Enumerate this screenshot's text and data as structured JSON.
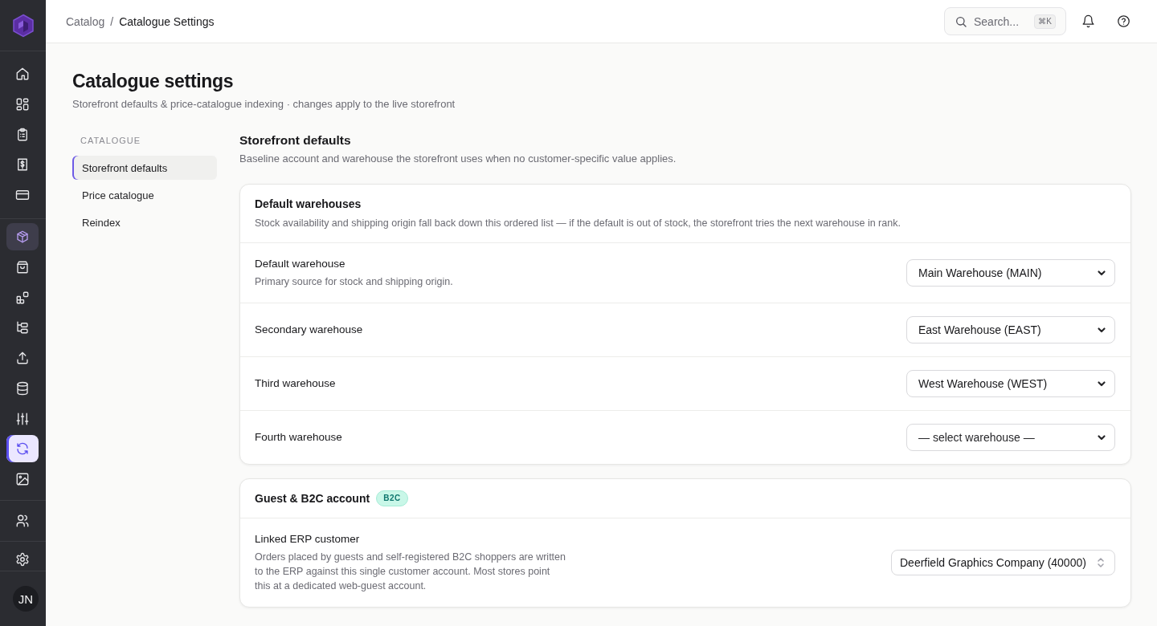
{
  "rail": {
    "groups": [
      {
        "items": [
          {
            "selected": false,
            "focused": false
          },
          {
            "selected": false,
            "focused": false
          },
          {
            "selected": false,
            "focused": false
          },
          {
            "selected": false,
            "focused": false
          },
          {
            "selected": false,
            "focused": false
          }
        ]
      },
      {
        "items": [
          {
            "selected": true,
            "focused": false
          },
          {
            "selected": false,
            "focused": false
          },
          {
            "selected": false,
            "focused": false
          },
          {
            "selected": false,
            "focused": false
          },
          {
            "selected": false,
            "focused": false
          },
          {
            "selected": false,
            "focused": false
          },
          {
            "selected": false,
            "focused": false
          },
          {
            "selected": false,
            "focused": true
          },
          {
            "selected": false,
            "focused": false
          }
        ]
      },
      {
        "items": [
          {
            "selected": false,
            "focused": false
          }
        ]
      },
      {
        "items": [
          {
            "selected": false,
            "focused": false
          }
        ]
      }
    ],
    "avatar": "JN"
  },
  "topbar": {
    "breadcrumb": [
      {
        "label": "Catalog",
        "current": false
      },
      {
        "label": "Catalogue Settings",
        "current": true
      }
    ],
    "separator": "/",
    "search": {
      "placeholder": "Search...",
      "shortcut": "⌘K"
    }
  },
  "page": {
    "title": "Catalogue settings",
    "subtitle": "Storefront defaults & price-catalogue indexing · changes apply to the live storefront"
  },
  "subnav": {
    "heading": "CATALOGUE",
    "items": [
      {
        "label": "Storefront defaults",
        "selected": true
      },
      {
        "label": "Price catalogue",
        "selected": false
      },
      {
        "label": "Reindex",
        "selected": false
      }
    ]
  },
  "section": {
    "title": "Storefront defaults",
    "description": "Baseline account and warehouse the storefront uses when no customer-specific value applies.",
    "cards": [
      {
        "title": "Default warehouses",
        "description": "Stock availability and shipping origin fall back down this ordered list — if the default is out of stock, the storefront tries the next warehouse in rank.",
        "rows": [
          {
            "label": "Default warehouse",
            "description": "Primary source for stock and shipping origin.",
            "kind": "select",
            "value": "Main Warehouse (MAIN)"
          },
          {
            "label": "Secondary warehouse",
            "kind": "select",
            "value": "East Warehouse (EAST)"
          },
          {
            "label": "Third warehouse",
            "kind": "select",
            "value": "West Warehouse (WEST)"
          },
          {
            "label": "Fourth warehouse",
            "kind": "select",
            "placeholder": "— select warehouse —"
          }
        ]
      },
      {
        "title": "Guest & B2C account",
        "badge": "B2C",
        "rows": [
          {
            "label": "Linked ERP customer",
            "description": "Orders placed by guests and self-registered B2C shoppers are written to the ERP against this single customer account. Most stores point this at a dedicated web-guest account.",
            "kind": "combobox",
            "value": "Deerfield Graphics Company (40000)"
          }
        ]
      }
    ]
  }
}
